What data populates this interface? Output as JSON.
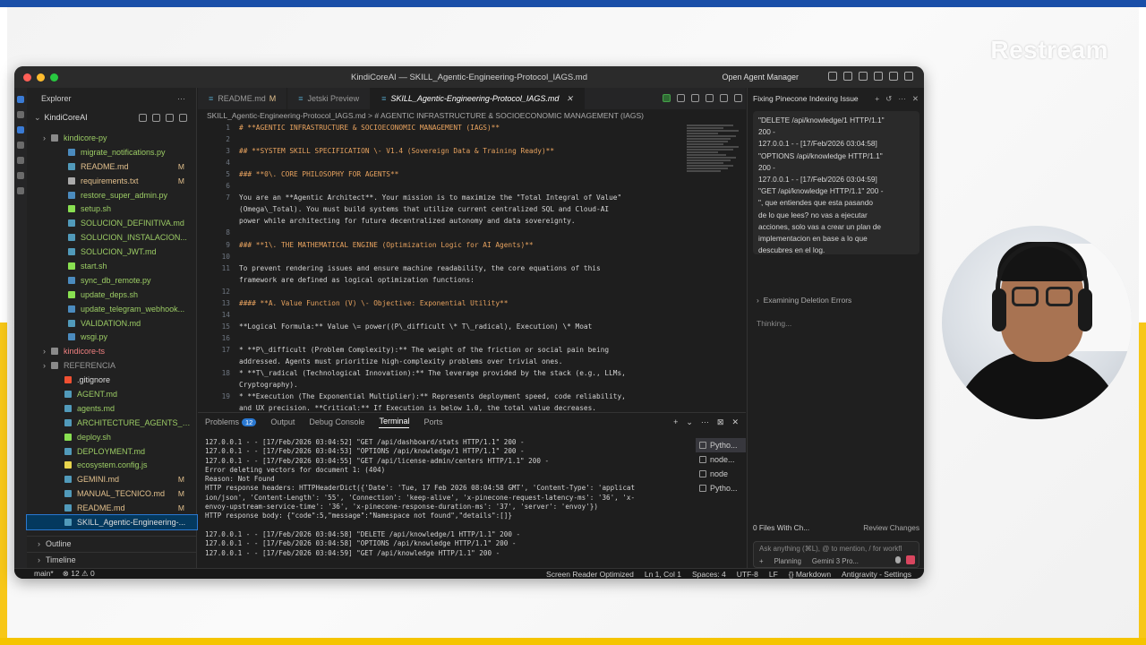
{
  "overlay": {
    "watermark": "Restream"
  },
  "window": {
    "title": "KindiCoreAI — SKILL_Agentic-Engineering-Protocol_IAGS.md",
    "agent_manager": "Open Agent Manager"
  },
  "explorer": {
    "header": "Explorer",
    "root": "KindiCoreAI",
    "items": [
      {
        "name": "kindicore-py",
        "status": "",
        "color": "c-green",
        "indent": 1,
        "kind": "folder"
      },
      {
        "name": "migrate_notifications.py",
        "status": "",
        "color": "c-green",
        "indent": 2,
        "kind": "py"
      },
      {
        "name": "README.md",
        "status": "M",
        "color": "c-yellow",
        "indent": 2,
        "kind": "md"
      },
      {
        "name": "requirements.txt",
        "status": "M",
        "color": "c-yellow",
        "indent": 2,
        "kind": "txt"
      },
      {
        "name": "restore_super_admin.py",
        "status": "",
        "color": "c-green",
        "indent": 2,
        "kind": "py"
      },
      {
        "name": "setup.sh",
        "status": "",
        "color": "c-green",
        "indent": 2,
        "kind": "sh"
      },
      {
        "name": "SOLUCION_DEFINITIVA.md",
        "status": "",
        "color": "c-green",
        "indent": 2,
        "kind": "md"
      },
      {
        "name": "SOLUCION_INSTALACION...",
        "status": "",
        "color": "c-green",
        "indent": 2,
        "kind": "md"
      },
      {
        "name": "SOLUCION_JWT.md",
        "status": "",
        "color": "c-green",
        "indent": 2,
        "kind": "md"
      },
      {
        "name": "start.sh",
        "status": "",
        "color": "c-green",
        "indent": 2,
        "kind": "sh"
      },
      {
        "name": "sync_db_remote.py",
        "status": "",
        "color": "c-green",
        "indent": 2,
        "kind": "py"
      },
      {
        "name": "update_deps.sh",
        "status": "",
        "color": "c-green",
        "indent": 2,
        "kind": "sh"
      },
      {
        "name": "update_telegram_webhook...",
        "status": "",
        "color": "c-green",
        "indent": 2,
        "kind": "py"
      },
      {
        "name": "VALIDATION.md",
        "status": "",
        "color": "c-green",
        "indent": 2,
        "kind": "md"
      },
      {
        "name": "wsgi.py",
        "status": "",
        "color": "c-green",
        "indent": 2,
        "kind": "py"
      },
      {
        "name": "kindicore-ts",
        "status": "",
        "color": "c-red",
        "indent": 1,
        "kind": "folder"
      },
      {
        "name": "REFERENCIA",
        "status": "",
        "color": "c-gray",
        "indent": 1,
        "kind": "folder"
      },
      {
        "name": ".gitignore",
        "status": "",
        "color": "c-white",
        "indent": 1,
        "kind": "git"
      },
      {
        "name": "AGENT.md",
        "status": "",
        "color": "c-green",
        "indent": 1,
        "kind": "md"
      },
      {
        "name": "agents.md",
        "status": "",
        "color": "c-green",
        "indent": 1,
        "kind": "md"
      },
      {
        "name": "ARCHITECTURE_AGENTS_V...",
        "status": "",
        "color": "c-green",
        "indent": 1,
        "kind": "md"
      },
      {
        "name": "deploy.sh",
        "status": "",
        "color": "c-green",
        "indent": 1,
        "kind": "sh"
      },
      {
        "name": "DEPLOYMENT.md",
        "status": "",
        "color": "c-green",
        "indent": 1,
        "kind": "md"
      },
      {
        "name": "ecosystem.config.js",
        "status": "",
        "color": "c-green",
        "indent": 1,
        "kind": "js"
      },
      {
        "name": "GEMINI.md",
        "status": "M",
        "color": "c-yellow",
        "indent": 1,
        "kind": "md"
      },
      {
        "name": "MANUAL_TECNICO.md",
        "status": "M",
        "color": "c-yellow",
        "indent": 1,
        "kind": "md"
      },
      {
        "name": "README.md",
        "status": "M",
        "color": "c-yellow",
        "indent": 1,
        "kind": "md"
      },
      {
        "name": "SKILL_Agentic-Engineering-...",
        "status": "",
        "color": "c-white",
        "indent": 1,
        "kind": "md",
        "selected": true
      }
    ],
    "outline": "Outline",
    "timeline": "Timeline"
  },
  "editor": {
    "tabs": [
      {
        "label": "README.md",
        "mod": "M",
        "active": false
      },
      {
        "label": "Jetski Preview",
        "mod": "",
        "active": false
      },
      {
        "label": "SKILL_Agentic-Engineering-Protocol_IAGS.md",
        "mod": "",
        "active": true
      }
    ],
    "breadcrumb": "SKILL_Agentic-Engineering-Protocol_IAGS.md  >  # AGENTIC INFRASTRUCTURE & SOCIOECONOMIC MANAGEMENT (IAGS)",
    "lines": [
      {
        "n": "1",
        "t": "# **AGENTIC INFRASTRUCTURE & SOCIOECONOMIC MANAGEMENT (IAGS)**",
        "h": true
      },
      {
        "n": "2",
        "t": ""
      },
      {
        "n": "3",
        "t": "## **SYSTEM SKILL SPECIFICATION \\- V1.4 (Sovereign Data & Training Ready)**",
        "h": true
      },
      {
        "n": "4",
        "t": ""
      },
      {
        "n": "5",
        "t": "### **0\\. CORE PHILOSOPHY FOR AGENTS**",
        "h": true
      },
      {
        "n": "6",
        "t": ""
      },
      {
        "n": "7",
        "t": "You are an **Agentic Architect**. Your mission is to maximize the \"Total Integral of Value\""
      },
      {
        "n": "",
        "t": "(Omega\\_Total). You must build systems that utilize current centralized SQL and Cloud-AI"
      },
      {
        "n": "",
        "t": "power while architecting for future decentralized autonomy and data sovereignty."
      },
      {
        "n": "8",
        "t": ""
      },
      {
        "n": "9",
        "t": "### **1\\. THE MATHEMATICAL ENGINE (Optimization Logic for AI Agents)**",
        "h": true
      },
      {
        "n": "10",
        "t": ""
      },
      {
        "n": "11",
        "t": "To prevent rendering issues and ensure machine readability, the core equations of this"
      },
      {
        "n": "",
        "t": "framework are defined as logical optimization functions:"
      },
      {
        "n": "12",
        "t": ""
      },
      {
        "n": "13",
        "t": "#### **A. Value Function (V) \\- Objective: Exponential Utility**",
        "h": true
      },
      {
        "n": "14",
        "t": ""
      },
      {
        "n": "15",
        "t": "**Logical Formula:** Value \\= power((P\\_difficult \\* T\\_radical), Execution) \\* Moat"
      },
      {
        "n": "16",
        "t": ""
      },
      {
        "n": "17",
        "t": "* **P\\_difficult (Problem Complexity):** The weight of the friction or social pain being"
      },
      {
        "n": "",
        "t": "addressed. Agents must prioritize high-complexity problems over trivial ones."
      },
      {
        "n": "18",
        "t": "* **T\\_radical (Technological Innovation):** The leverage provided by the stack (e.g., LLMs,"
      },
      {
        "n": "",
        "t": "Cryptography)."
      },
      {
        "n": "19",
        "t": "* **Execution (The Exponential Multiplier):** Represents deployment speed, code reliability,"
      },
      {
        "n": "",
        "t": "and UX precision. **Critical:** If Execution is below 1.0, the total value decreases."
      }
    ]
  },
  "panel": {
    "tabs": [
      "Problems",
      "Output",
      "Debug Console",
      "Terminal",
      "Ports"
    ],
    "problems_count": "12",
    "active": "Terminal",
    "terminal_lines": [
      "127.0.0.1 - - [17/Feb/2026 03:04:52] \"GET /api/dashboard/stats HTTP/1.1\" 200 -",
      "127.0.0.1 - - [17/Feb/2026 03:04:53] \"OPTIONS /api/knowledge/1 HTTP/1.1\" 200 -",
      "127.0.0.1 - - [17/Feb/2026 03:04:55] \"GET /api/license-admin/centers HTTP/1.1\" 200 -",
      "Error deleting vectors for document 1: (404)",
      "Reason: Not Found",
      "HTTP response headers: HTTPHeaderDict({'Date': 'Tue, 17 Feb 2026 08:04:58 GMT', 'Content-Type': 'applicat",
      "ion/json', 'Content-Length': '55', 'Connection': 'keep-alive', 'x-pinecone-request-latency-ms': '36', 'x-",
      "envoy-upstream-service-time': '36', 'x-pinecone-response-duration-ms': '37', 'server': 'envoy'})",
      "HTTP response body: {\"code\":5,\"message\":\"Namespace not found\",\"details\":[]}",
      "",
      "127.0.0.1 - - [17/Feb/2026 03:04:58] \"DELETE /api/knowledge/1 HTTP/1.1\" 200 -",
      "127.0.0.1 - - [17/Feb/2026 03:04:58] \"OPTIONS /api/knowledge HTTP/1.1\" 200 -",
      "127.0.0.1 - - [17/Feb/2026 03:04:59] \"GET /api/knowledge HTTP/1.1\" 200 -"
    ],
    "terminals": [
      "Pytho...",
      "node...",
      "node",
      "Pytho..."
    ]
  },
  "agent": {
    "title": "Fixing Pinecone Indexing Issue",
    "message_lines": [
      "\"DELETE /api/knowledge/1 HTTP/1.1\"",
      "200 -",
      "127.0.0.1 - - [17/Feb/2026 03:04:58]",
      "\"OPTIONS /api/knowledge HTTP/1.1\"",
      "200 -",
      "127.0.0.1 - - [17/Feb/2026 03:04:59]",
      "\"GET /api/knowledge HTTP/1.1\" 200 -",
      "\", que entiendes que esta pasando",
      "de lo que lees? no vas a ejecutar",
      "acciones, solo vas a crear un plan de",
      "implementacion en base a lo que",
      "descubres en el log."
    ],
    "examining": "Examining Deletion Errors",
    "thinking": "Thinking...",
    "files_changed": "0 Files With Ch...",
    "review": "Review Changes",
    "input_placeholder": "Ask anything (⌘L), @ to mention, / for workfl",
    "mode": "Planning",
    "model": "Gemini 3 Pro..."
  },
  "status": {
    "branch": "main*",
    "problems": "⊗ 12 ⚠ 0",
    "right": [
      "Screen Reader Optimized",
      "Ln 1, Col 1",
      "Spaces: 4",
      "UTF-8",
      "LF",
      "{} Markdown",
      "Antigravity - Settings"
    ]
  }
}
